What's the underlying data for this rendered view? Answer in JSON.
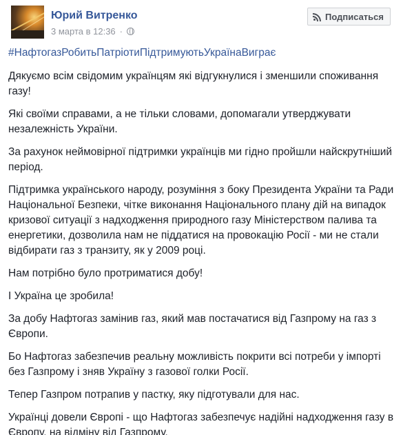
{
  "post": {
    "author": "Юрий Витренко",
    "date": "3 марта в 12:36",
    "separator": "·",
    "subscribe_label": "Подписаться",
    "hashtag": "#НафтогазРобитьПатріотиПідтримуютьУкраїнаВиграє",
    "paragraphs": [
      "Дякуємо всім свідомим українцям які відгукнулися і зменшили споживання газу!",
      "Які своїми справами, а не тільки словами, допомагали утверджувати незалежність України.",
      "За рахунок неймовірної підтримки українців ми гідно пройшли найскрутніший період.",
      "Підтримка українського народу, розуміння з боку Президента України та Ради Національної Безпеки, чітке виконання Національного плану дій на випадок кризової ситуації з надходження природного газу Міністерством палива та енергетики, дозволила нам не піддатися на провокацію Росії - ми не стали відбирати газ з транзиту, як у 2009 році.",
      "Нам потрібно було протриматися добу!",
      "І Україна це зробила!",
      "За добу Нафтогаз замінив газ, який мав постачатися від Газпрому на газ з Європи.",
      "Бо Нафтогаз забезпечив реальну можливість покрити всі потреби у імпорті без Газпрому і зняв Україну з газової голки Росії.",
      "Тепер Газпром потрапив у пастку, яку підготували для нас.",
      "Українці довели Європі - що Нафтогаз забезпечує надійні надходження газу в Європу, на відміну від Газпрому."
    ]
  },
  "icons": {
    "audience": "globe-icon",
    "subscribe": "rss-icon"
  },
  "colors": {
    "link": "#365899",
    "text": "#1d2129",
    "meta": "#90949c",
    "button_bg": "#f5f6f7",
    "button_border": "#ced0d4"
  }
}
